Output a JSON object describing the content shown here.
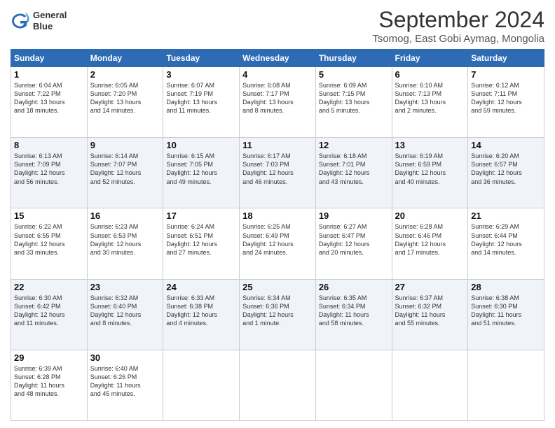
{
  "logo": {
    "line1": "General",
    "line2": "Blue"
  },
  "title": "September 2024",
  "subtitle": "Tsomog, East Gobi Aymag, Mongolia",
  "weekdays": [
    "Sunday",
    "Monday",
    "Tuesday",
    "Wednesday",
    "Thursday",
    "Friday",
    "Saturday"
  ],
  "weeks": [
    [
      {
        "day": "1",
        "text": "Sunrise: 6:04 AM\nSunset: 7:22 PM\nDaylight: 13 hours\nand 18 minutes."
      },
      {
        "day": "2",
        "text": "Sunrise: 6:05 AM\nSunset: 7:20 PM\nDaylight: 13 hours\nand 14 minutes."
      },
      {
        "day": "3",
        "text": "Sunrise: 6:07 AM\nSunset: 7:19 PM\nDaylight: 13 hours\nand 11 minutes."
      },
      {
        "day": "4",
        "text": "Sunrise: 6:08 AM\nSunset: 7:17 PM\nDaylight: 13 hours\nand 8 minutes."
      },
      {
        "day": "5",
        "text": "Sunrise: 6:09 AM\nSunset: 7:15 PM\nDaylight: 13 hours\nand 5 minutes."
      },
      {
        "day": "6",
        "text": "Sunrise: 6:10 AM\nSunset: 7:13 PM\nDaylight: 13 hours\nand 2 minutes."
      },
      {
        "day": "7",
        "text": "Sunrise: 6:12 AM\nSunset: 7:11 PM\nDaylight: 12 hours\nand 59 minutes."
      }
    ],
    [
      {
        "day": "8",
        "text": "Sunrise: 6:13 AM\nSunset: 7:09 PM\nDaylight: 12 hours\nand 56 minutes."
      },
      {
        "day": "9",
        "text": "Sunrise: 6:14 AM\nSunset: 7:07 PM\nDaylight: 12 hours\nand 52 minutes."
      },
      {
        "day": "10",
        "text": "Sunrise: 6:15 AM\nSunset: 7:05 PM\nDaylight: 12 hours\nand 49 minutes."
      },
      {
        "day": "11",
        "text": "Sunrise: 6:17 AM\nSunset: 7:03 PM\nDaylight: 12 hours\nand 46 minutes."
      },
      {
        "day": "12",
        "text": "Sunrise: 6:18 AM\nSunset: 7:01 PM\nDaylight: 12 hours\nand 43 minutes."
      },
      {
        "day": "13",
        "text": "Sunrise: 6:19 AM\nSunset: 6:59 PM\nDaylight: 12 hours\nand 40 minutes."
      },
      {
        "day": "14",
        "text": "Sunrise: 6:20 AM\nSunset: 6:57 PM\nDaylight: 12 hours\nand 36 minutes."
      }
    ],
    [
      {
        "day": "15",
        "text": "Sunrise: 6:22 AM\nSunset: 6:55 PM\nDaylight: 12 hours\nand 33 minutes."
      },
      {
        "day": "16",
        "text": "Sunrise: 6:23 AM\nSunset: 6:53 PM\nDaylight: 12 hours\nand 30 minutes."
      },
      {
        "day": "17",
        "text": "Sunrise: 6:24 AM\nSunset: 6:51 PM\nDaylight: 12 hours\nand 27 minutes."
      },
      {
        "day": "18",
        "text": "Sunrise: 6:25 AM\nSunset: 6:49 PM\nDaylight: 12 hours\nand 24 minutes."
      },
      {
        "day": "19",
        "text": "Sunrise: 6:27 AM\nSunset: 6:47 PM\nDaylight: 12 hours\nand 20 minutes."
      },
      {
        "day": "20",
        "text": "Sunrise: 6:28 AM\nSunset: 6:46 PM\nDaylight: 12 hours\nand 17 minutes."
      },
      {
        "day": "21",
        "text": "Sunrise: 6:29 AM\nSunset: 6:44 PM\nDaylight: 12 hours\nand 14 minutes."
      }
    ],
    [
      {
        "day": "22",
        "text": "Sunrise: 6:30 AM\nSunset: 6:42 PM\nDaylight: 12 hours\nand 11 minutes."
      },
      {
        "day": "23",
        "text": "Sunrise: 6:32 AM\nSunset: 6:40 PM\nDaylight: 12 hours\nand 8 minutes."
      },
      {
        "day": "24",
        "text": "Sunrise: 6:33 AM\nSunset: 6:38 PM\nDaylight: 12 hours\nand 4 minutes."
      },
      {
        "day": "25",
        "text": "Sunrise: 6:34 AM\nSunset: 6:36 PM\nDaylight: 12 hours\nand 1 minute."
      },
      {
        "day": "26",
        "text": "Sunrise: 6:35 AM\nSunset: 6:34 PM\nDaylight: 11 hours\nand 58 minutes."
      },
      {
        "day": "27",
        "text": "Sunrise: 6:37 AM\nSunset: 6:32 PM\nDaylight: 11 hours\nand 55 minutes."
      },
      {
        "day": "28",
        "text": "Sunrise: 6:38 AM\nSunset: 6:30 PM\nDaylight: 11 hours\nand 51 minutes."
      }
    ],
    [
      {
        "day": "29",
        "text": "Sunrise: 6:39 AM\nSunset: 6:28 PM\nDaylight: 11 hours\nand 48 minutes."
      },
      {
        "day": "30",
        "text": "Sunrise: 6:40 AM\nSunset: 6:26 PM\nDaylight: 11 hours\nand 45 minutes."
      },
      {
        "day": "",
        "text": ""
      },
      {
        "day": "",
        "text": ""
      },
      {
        "day": "",
        "text": ""
      },
      {
        "day": "",
        "text": ""
      },
      {
        "day": "",
        "text": ""
      }
    ]
  ]
}
